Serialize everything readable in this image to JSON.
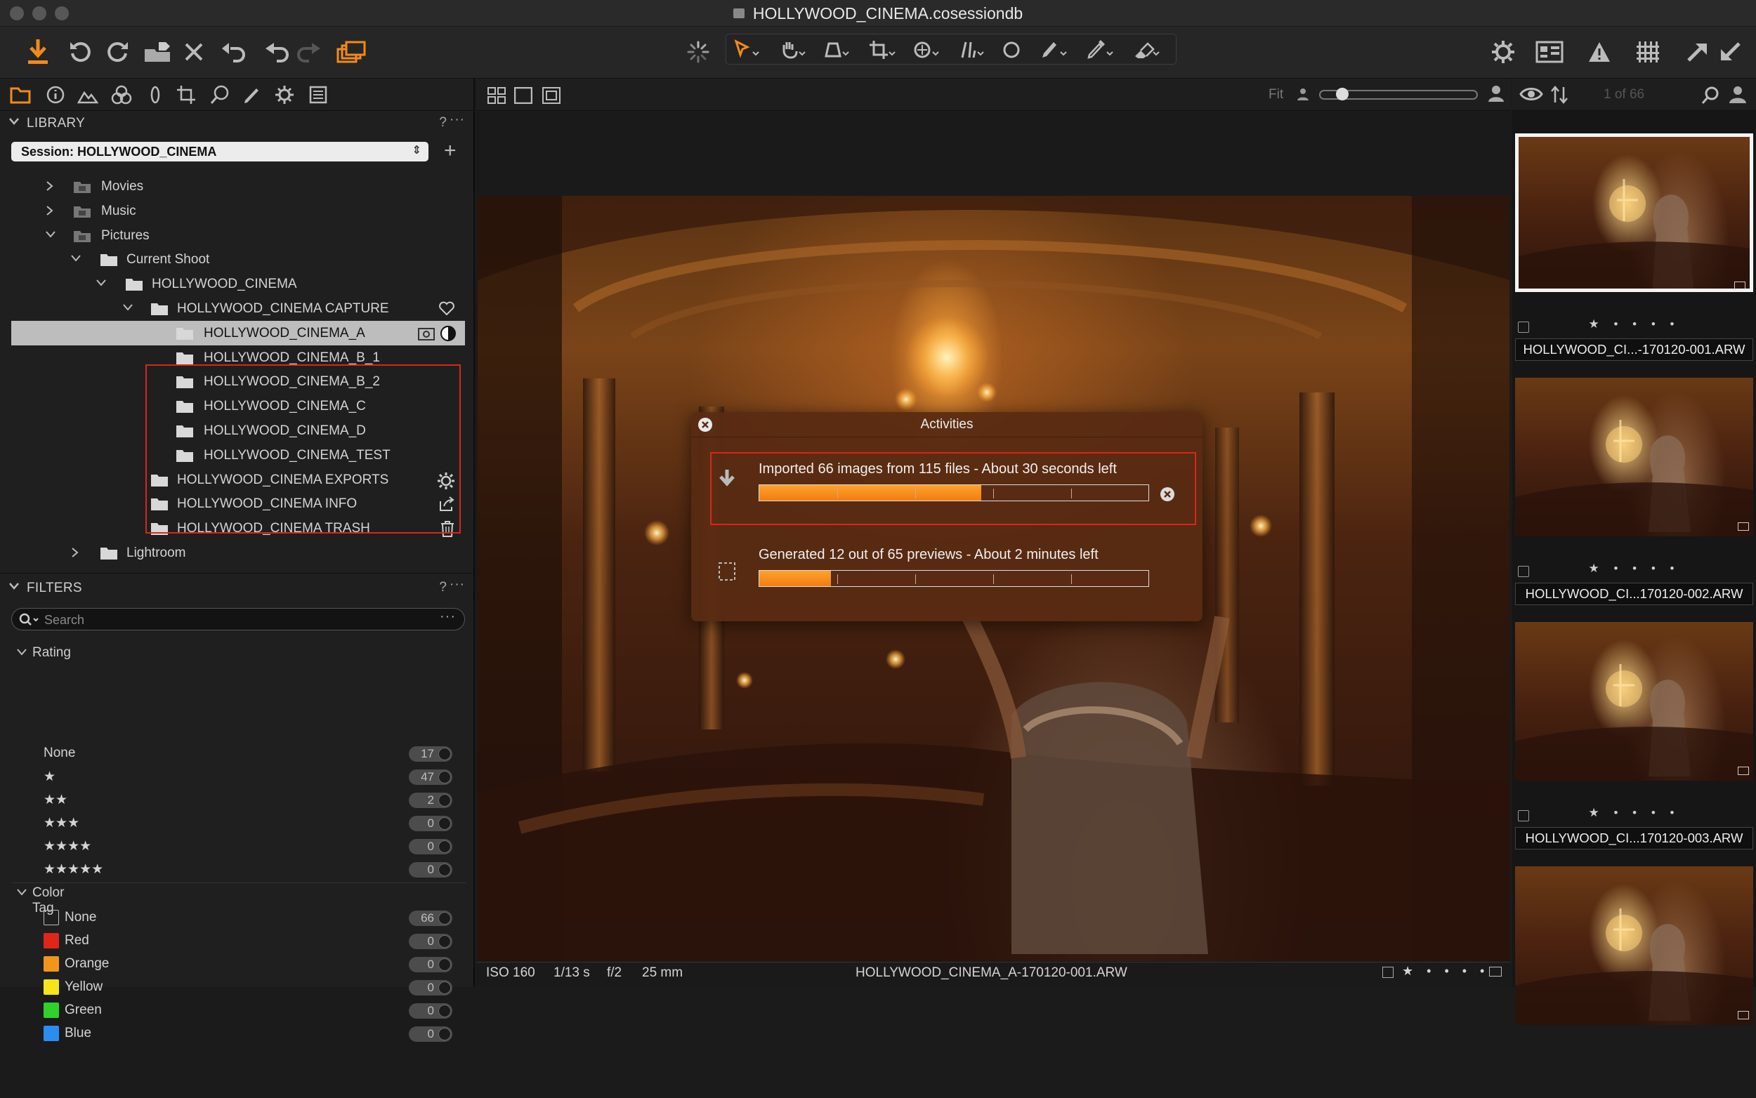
{
  "window": {
    "title": "HOLLYWOOD_CINEMA.cosessiondb"
  },
  "colors": {
    "accent": "#f28a1a",
    "highlight_box": "#d8261d",
    "selected_row": "#bdbdbd"
  },
  "toolbar": {
    "left_icons": [
      "import-icon",
      "rotate-left-icon",
      "rotate-right-icon",
      "move-to-folder-icon",
      "delete-icon",
      "undo-all-icon",
      "undo-icon",
      "redo-icon",
      "variants-icon"
    ],
    "center_icons": [
      "spinner-icon",
      "cursor-select-icon",
      "pan-icon",
      "loupe-icon",
      "crop-icon",
      "rotate-tool-icon",
      "keystone-icon",
      "spot-icon",
      "brush-icon",
      "eraser-icon",
      "picker-icon"
    ],
    "right_icons": [
      "settings-icon",
      "layout-icon",
      "warning-icon",
      "grid-icon",
      "export-icon",
      "process-icon"
    ]
  },
  "library": {
    "title": "LIBRARY",
    "help": "?",
    "more": "···",
    "session_label": "Session: HOLLYWOOD_CINEMA",
    "tree": [
      {
        "label": "Movies",
        "depth": 0,
        "twisty": "collapsed",
        "icon": "special-folder"
      },
      {
        "label": "Music",
        "depth": 0,
        "twisty": "collapsed",
        "icon": "special-folder"
      },
      {
        "label": "Pictures",
        "depth": 0,
        "twisty": "expanded",
        "icon": "special-folder"
      },
      {
        "label": "Current Shoot",
        "depth": 1,
        "twisty": "expanded",
        "icon": "folder"
      },
      {
        "label": "HOLLYWOOD_CINEMA",
        "depth": 2,
        "twisty": "expanded",
        "icon": "folder"
      },
      {
        "label": "HOLLYWOOD_CINEMA CAPTURE",
        "depth": 3,
        "twisty": "expanded",
        "icon": "folder",
        "action": "heart-icon"
      },
      {
        "label": "HOLLYWOOD_CINEMA_A",
        "depth": 4,
        "twisty": "none",
        "icon": "folder",
        "selected": true,
        "action": "camera-icon"
      },
      {
        "label": "HOLLYWOOD_CINEMA_B_1",
        "depth": 4,
        "twisty": "none",
        "icon": "folder"
      },
      {
        "label": "HOLLYWOOD_CINEMA_B_2",
        "depth": 4,
        "twisty": "none",
        "icon": "folder"
      },
      {
        "label": "HOLLYWOOD_CINEMA_C",
        "depth": 4,
        "twisty": "none",
        "icon": "folder"
      },
      {
        "label": "HOLLYWOOD_CINEMA_D",
        "depth": 4,
        "twisty": "none",
        "icon": "folder"
      },
      {
        "label": "HOLLYWOOD_CINEMA_TEST",
        "depth": 4,
        "twisty": "none",
        "icon": "folder"
      },
      {
        "label": "HOLLYWOOD_CINEMA EXPORTS",
        "depth": 3,
        "twisty": "none",
        "icon": "folder",
        "action": "gear-icon"
      },
      {
        "label": "HOLLYWOOD_CINEMA INFO",
        "depth": 3,
        "twisty": "none",
        "icon": "folder",
        "action": "share-icon"
      },
      {
        "label": "HOLLYWOOD_CINEMA TRASH",
        "depth": 3,
        "twisty": "none",
        "icon": "folder",
        "action": "trash-icon"
      },
      {
        "label": "Lightroom",
        "depth": 1,
        "twisty": "collapsed",
        "icon": "folder"
      }
    ]
  },
  "filters": {
    "title": "FILTERS",
    "help": "?",
    "more": "···",
    "search_placeholder": "Search",
    "rating": {
      "title": "Rating",
      "rows": [
        {
          "label": "None",
          "count": "17"
        },
        {
          "label": "★",
          "count": "47"
        },
        {
          "label": "★★",
          "count": "2"
        },
        {
          "label": "★★★",
          "count": "0"
        },
        {
          "label": "★★★★",
          "count": "0"
        },
        {
          "label": "★★★★★",
          "count": "0"
        }
      ]
    },
    "color_tag": {
      "title": "Color Tag",
      "rows": [
        {
          "label": "None",
          "count": "66",
          "color": "none"
        },
        {
          "label": "Red",
          "count": "0",
          "color": "#e0261b"
        },
        {
          "label": "Orange",
          "count": "0",
          "color": "#f2951b"
        },
        {
          "label": "Yellow",
          "count": "0",
          "color": "#f5e51a"
        },
        {
          "label": "Green",
          "count": "0",
          "color": "#2fd12a"
        },
        {
          "label": "Blue",
          "count": "0",
          "color": "#2a8ef0"
        }
      ]
    }
  },
  "viewer": {
    "zoom_label": "Fit",
    "meta": {
      "iso": "ISO 160",
      "shutter": "1/13 s",
      "aperture": "f/2",
      "focal": "25 mm",
      "filename": "HOLLYWOOD_CINEMA_A-170120-001.ARW"
    }
  },
  "activities": {
    "title": "Activities",
    "items": [
      {
        "message": "Imported 66 images from 115 files - About 30 seconds left",
        "progress": 0.57
      },
      {
        "message": "Generated 12 out of 65 previews - About 2 minutes left",
        "progress": 0.185
      }
    ]
  },
  "filmstrip": {
    "counter": "1 of 66",
    "items": [
      {
        "name": "HOLLYWOOD_CI...-170120-001.ARW",
        "selected": true
      },
      {
        "name": "HOLLYWOOD_CI...170120-002.ARW",
        "selected": false
      },
      {
        "name": "HOLLYWOOD_CI...170120-003.ARW",
        "selected": false
      },
      {
        "name": "",
        "selected": false
      }
    ]
  }
}
